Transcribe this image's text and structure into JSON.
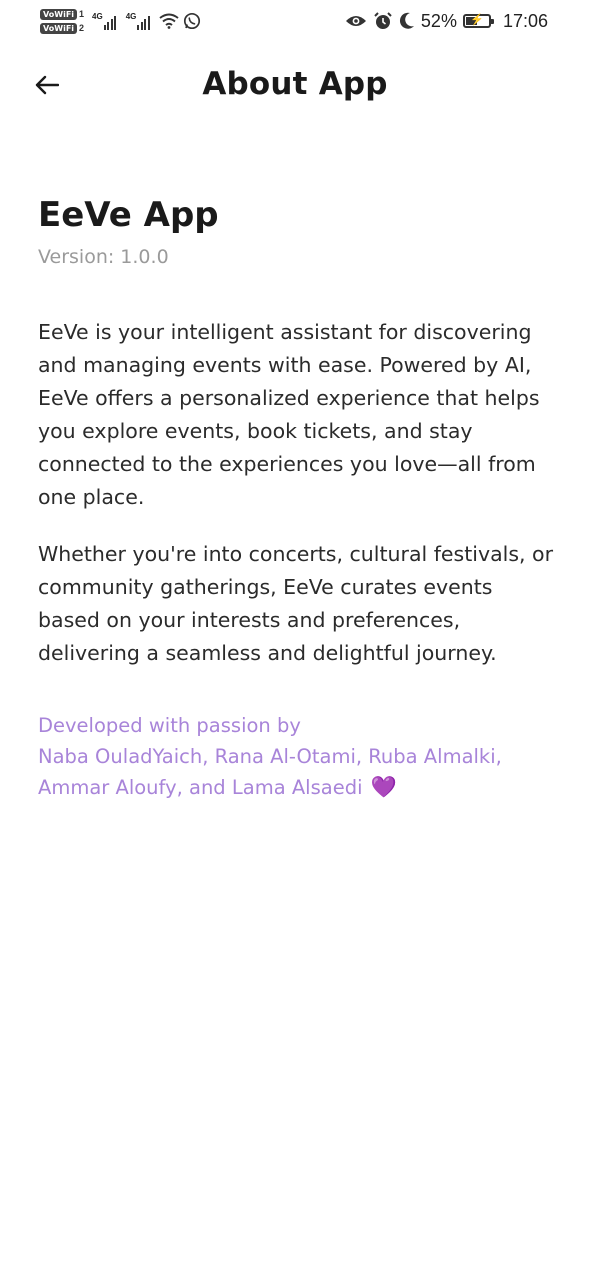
{
  "status_bar": {
    "vowifi_label": "VoWiFi",
    "sim1": "1",
    "sim2": "2",
    "network1": "4G",
    "network2": "4G",
    "battery": "52%",
    "battery_level": 0.52,
    "time": "17:06",
    "icons": [
      "wifi-icon",
      "whatsapp-icon",
      "eye-icon",
      "alarm-icon",
      "moon-icon",
      "battery-icon"
    ]
  },
  "header": {
    "back_icon": "arrow-left-icon",
    "title": "About App"
  },
  "about": {
    "app_name": "EeVe App",
    "version": "Version: 1.0.0",
    "description_1": "EeVe is your intelligent assistant for discovering and managing events with ease. Powered by AI, EeVe offers a personalized experience that helps you explore events, book tickets, and stay connected to the experiences you love—all from one place.",
    "description_2": "Whether you're into concerts, cultural festivals, or community gatherings, EeVe curates events based on your interests and preferences, delivering a seamless and delightful journey.",
    "credits_intro": "Developed with passion by",
    "credits_names": "Naba OuladYaich, Rana Al-Otami, Ruba Almalki, Ammar Aloufy, and Lama Alsaedi",
    "heart": "💜",
    "accent_color": "#a884d9"
  }
}
